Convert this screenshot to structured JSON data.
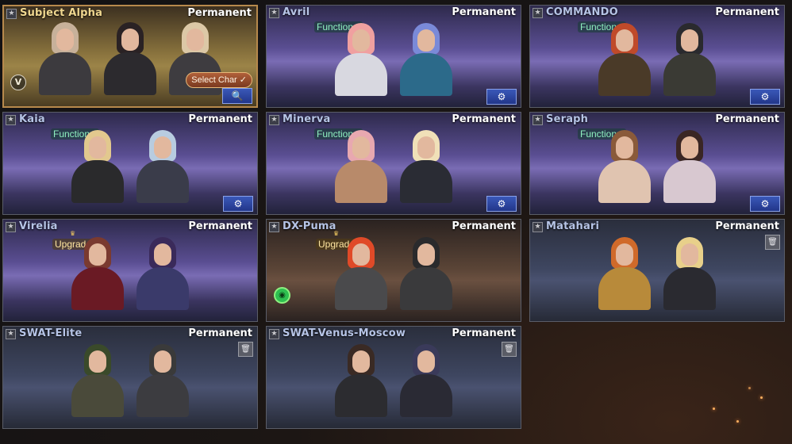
{
  "cards": [
    {
      "name": "Subject Alpha",
      "status": "Permanent",
      "theme": "gold",
      "tag": "",
      "action": "search",
      "action_glyph": "🔍",
      "select_label": "Select Char ✓",
      "figures": [
        {
          "hair": "#c7b19a",
          "body": "#3c3a3e"
        },
        {
          "hair": "#2a2224",
          "body": "#2c2a2e"
        },
        {
          "hair": "#dcc8a6",
          "body": "#3e3c40"
        }
      ]
    },
    {
      "name": "Avril",
      "status": "Permanent",
      "theme": "purple",
      "tag": "Functional",
      "action": "customize",
      "action_glyph": "⚙",
      "figures": [
        {
          "hair": "#f0a0a0",
          "body": "#d8d8e0"
        },
        {
          "hair": "#7a8ad8",
          "body": "#2c6a8a"
        }
      ]
    },
    {
      "name": "COMMANDO",
      "status": "Permanent",
      "theme": "purple",
      "tag": "Functional",
      "action": "customize",
      "action_glyph": "⚙",
      "figures": [
        {
          "hair": "#c04a2a",
          "body": "#4a3a28"
        },
        {
          "hair": "#2a2a2e",
          "body": "#3a3a34"
        }
      ]
    },
    {
      "name": "Kaia",
      "status": "Permanent",
      "theme": "purple",
      "tag": "Functional",
      "action": "customize",
      "action_glyph": "⚙",
      "figures": [
        {
          "hair": "#e2c88e",
          "body": "#2a2a2c"
        },
        {
          "hair": "#b8cce0",
          "body": "#3a3c4a"
        }
      ]
    },
    {
      "name": "Minerva",
      "status": "Permanent",
      "theme": "purple",
      "tag": "Functional",
      "action": "customize",
      "action_glyph": "⚙",
      "figures": [
        {
          "hair": "#e8a8b0",
          "body": "#b88a6a"
        },
        {
          "hair": "#f0e0b8",
          "body": "#2a2c34"
        }
      ]
    },
    {
      "name": "Seraph",
      "status": "Permanent",
      "theme": "purple",
      "tag": "Functional",
      "action": "customize",
      "action_glyph": "⚙",
      "figures": [
        {
          "hair": "#8a5a3a",
          "body": "#e0c4b0"
        },
        {
          "hair": "#3a2624",
          "body": "#d8c8d0"
        }
      ]
    },
    {
      "name": "Virelia",
      "status": "Permanent",
      "theme": "purple",
      "tag": "Upgrade",
      "action": "",
      "action_glyph": "",
      "figures": [
        {
          "hair": "#7a3a30",
          "body": "#6a1a24"
        },
        {
          "hair": "#3a2a5a",
          "body": "#3a3a6a"
        }
      ]
    },
    {
      "name": "DX-Puma",
      "status": "Permanent",
      "theme": "brown",
      "tag": "Upgrade",
      "action": "",
      "action_glyph": "",
      "figures": [
        {
          "hair": "#e04a28",
          "body": "#4a4a4c"
        },
        {
          "hair": "#2a2a2c",
          "body": "#3a3a3c"
        }
      ]
    },
    {
      "name": "Matahari",
      "status": "Permanent",
      "theme": "steel",
      "tag": "",
      "action": "delete",
      "action_glyph": "🗑",
      "figures": [
        {
          "hair": "#d06a2a",
          "body": "#b88a3a"
        },
        {
          "hair": "#e8d08a",
          "body": "#2a2a30"
        }
      ]
    },
    {
      "name": "SWAT-Elite",
      "status": "Permanent",
      "theme": "steel",
      "tag": "",
      "action": "delete",
      "action_glyph": "🗑",
      "figures": [
        {
          "hair": "#3a4a2a",
          "body": "#4a4a3a"
        },
        {
          "hair": "#3a3a3a",
          "body": "#3c3c40"
        }
      ]
    },
    {
      "name": "SWAT-Venus-Moscow",
      "status": "Permanent",
      "theme": "steel",
      "tag": "",
      "action": "delete",
      "action_glyph": "🗑",
      "figures": [
        {
          "hair": "#3a2a24",
          "body": "#2c2c30"
        },
        {
          "hair": "#3a3a5a",
          "body": "#2a2a34"
        }
      ]
    }
  ]
}
